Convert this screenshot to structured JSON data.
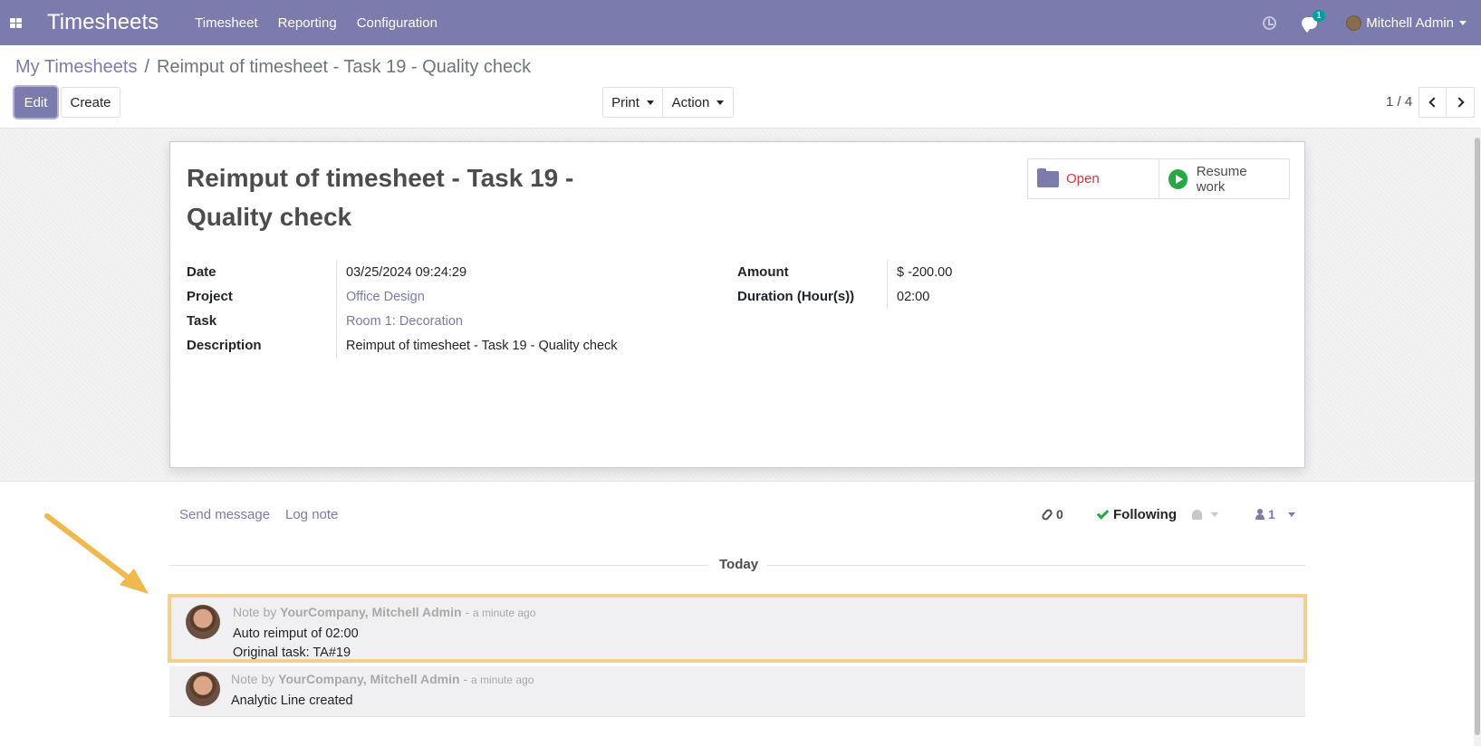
{
  "navbar": {
    "app_title": "Timesheets",
    "menu": [
      "Timesheet",
      "Reporting",
      "Configuration"
    ],
    "chat_badge": "1",
    "user_name": "Mitchell Admin"
  },
  "breadcrumb": {
    "parent": "My Timesheets",
    "separator": "/",
    "current": "Reimput of timesheet - Task 19 - Quality check"
  },
  "toolbar": {
    "edit_label": "Edit",
    "create_label": "Create",
    "print_label": "Print",
    "action_label": "Action"
  },
  "pager": {
    "value": "1 / 4"
  },
  "form": {
    "title": "Reimput of timesheet - Task 19 - Quality check",
    "smart_buttons": {
      "open_label": "Open",
      "resume_label": "Resume work"
    },
    "left_fields": [
      {
        "label": "Date",
        "value": "03/25/2024 09:24:29"
      },
      {
        "label": "Project",
        "value": "Office Design"
      },
      {
        "label": "Task",
        "value": "Room 1: Decoration"
      },
      {
        "label": "Description",
        "value": "Reimput of timesheet - Task 19 - Quality check"
      }
    ],
    "right_fields": [
      {
        "label": "Amount",
        "value": "$ -200.00"
      },
      {
        "label": "Duration (Hour(s))",
        "value": "02:00"
      }
    ]
  },
  "chatter": {
    "send_message": "Send message",
    "log_note": "Log note",
    "attachments_count": "0",
    "following_label": "Following",
    "followers_count": "1",
    "date_separator": "Today",
    "messages": [
      {
        "type": "Note by",
        "author": "YourCompany, Mitchell Admin",
        "dash": "-",
        "time": "a minute ago",
        "lines": [
          "Auto reimput of 02:00",
          "Original task: TA#19"
        ]
      },
      {
        "type": "Note by",
        "author": "YourCompany, Mitchell Admin",
        "dash": "-",
        "time": "a minute ago",
        "lines": [
          "Analytic Line created"
        ]
      }
    ]
  },
  "colors": {
    "brand": "#7c7bad",
    "highlight": "#f3d18d",
    "arrow": "#f0b94f"
  }
}
